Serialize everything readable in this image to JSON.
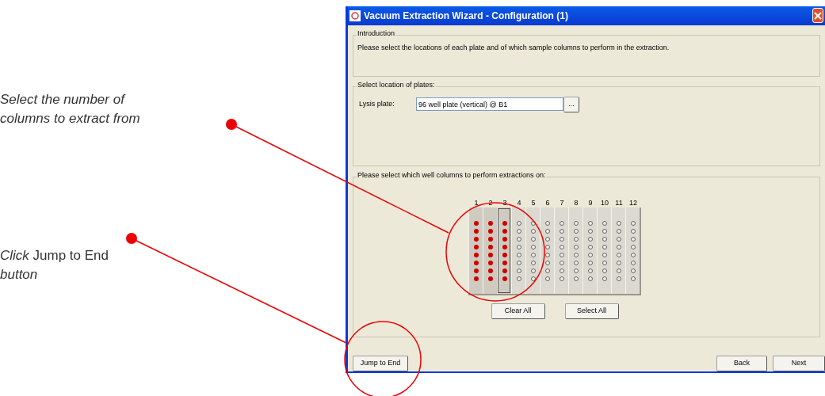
{
  "annotations": [
    {
      "text": "*Select the number of columns to extract from*"
    },
    {
      "text": "*Click* Jump to End *button*"
    }
  ],
  "window": {
    "title": "Vacuum Extraction Wizard - Configuration (1)"
  },
  "introduction": {
    "legend": "Introduction",
    "text": "Please select the locations of each plate and of which sample columns to perform in the extraction."
  },
  "plates": {
    "legend": "Select location of plates:",
    "label": "Lysis plate:",
    "value": "96 well plate (vertical) @ B1",
    "browse": "..."
  },
  "wells": {
    "legend": "Please select which well columns to perform extractions on:",
    "columns": [
      {
        "label": "1",
        "selected": true,
        "focused": false
      },
      {
        "label": "2",
        "selected": true,
        "focused": false
      },
      {
        "label": "3",
        "selected": true,
        "focused": true
      },
      {
        "label": "4",
        "selected": false,
        "focused": false
      },
      {
        "label": "5",
        "selected": false,
        "focused": false
      },
      {
        "label": "6",
        "selected": false,
        "focused": false
      },
      {
        "label": "7",
        "selected": false,
        "focused": false
      },
      {
        "label": "8",
        "selected": false,
        "focused": false
      },
      {
        "label": "9",
        "selected": false,
        "focused": false
      },
      {
        "label": "10",
        "selected": false,
        "focused": false
      },
      {
        "label": "11",
        "selected": false,
        "focused": false
      },
      {
        "label": "12",
        "selected": false,
        "focused": false
      }
    ],
    "buttons": [
      "Clear All",
      "Select All"
    ]
  },
  "footer": {
    "jump": "Jump to End",
    "back": "Back",
    "next": "Next"
  }
}
